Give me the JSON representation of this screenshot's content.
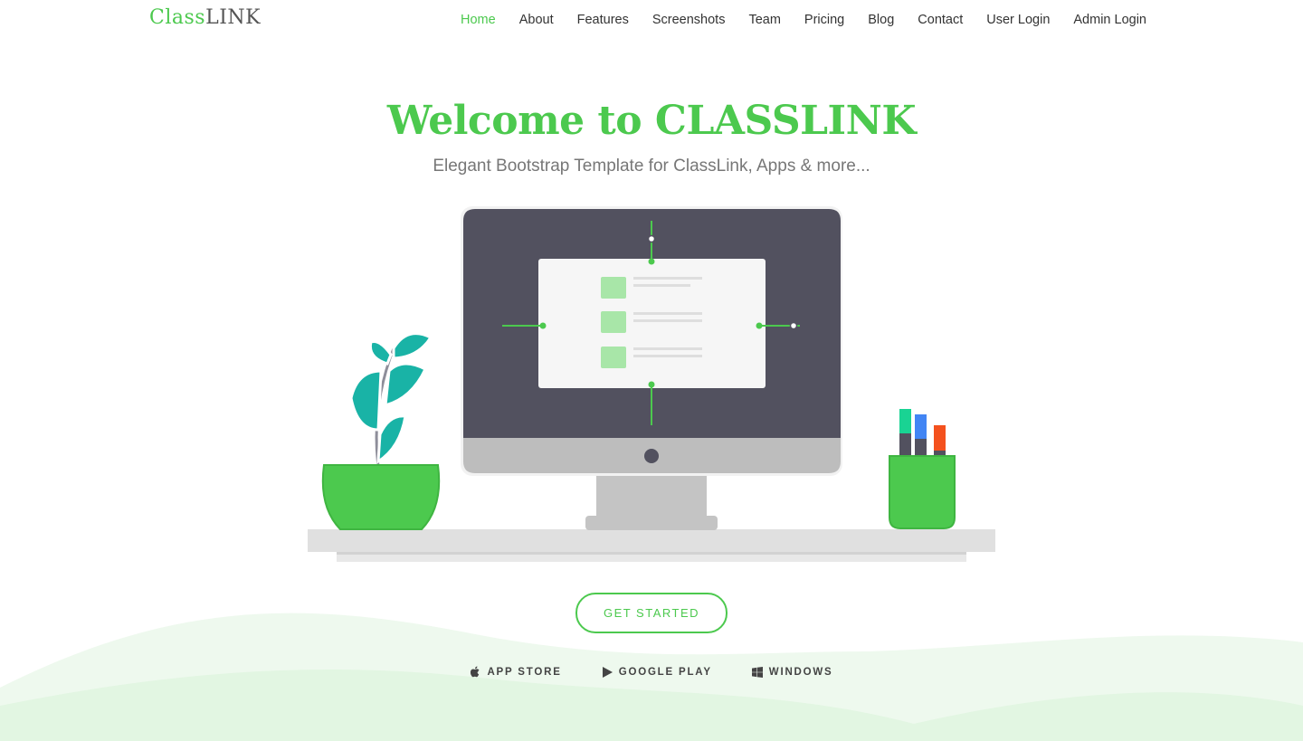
{
  "brand": {
    "logo_part1": "Class",
    "logo_part2": "LINK",
    "primary_color": "#4cc94e"
  },
  "nav": {
    "items": [
      {
        "label": "Home",
        "active": true
      },
      {
        "label": "About"
      },
      {
        "label": "Features"
      },
      {
        "label": "Screenshots"
      },
      {
        "label": "Team"
      },
      {
        "label": "Pricing"
      },
      {
        "label": "Blog"
      },
      {
        "label": "Contact"
      },
      {
        "label": "User Login"
      },
      {
        "label": "Admin Login"
      }
    ]
  },
  "hero": {
    "title": "Welcome to CLASSLINK",
    "subtitle": "Elegant Bootstrap Template for ClassLink, Apps & more..."
  },
  "cta": {
    "label": "GET STARTED"
  },
  "stores": [
    {
      "label": "APP STORE",
      "icon": "apple-icon"
    },
    {
      "label": "GOOGLE PLAY",
      "icon": "play-icon"
    },
    {
      "label": "WINDOWS",
      "icon": "windows-icon"
    }
  ],
  "colors": {
    "monitor_dark": "#52515f",
    "monitor_chin": "#bdbdbd",
    "leaf": "#19b3a6",
    "pot": "#4cc94e",
    "wave_light": "#e4f7e4"
  }
}
